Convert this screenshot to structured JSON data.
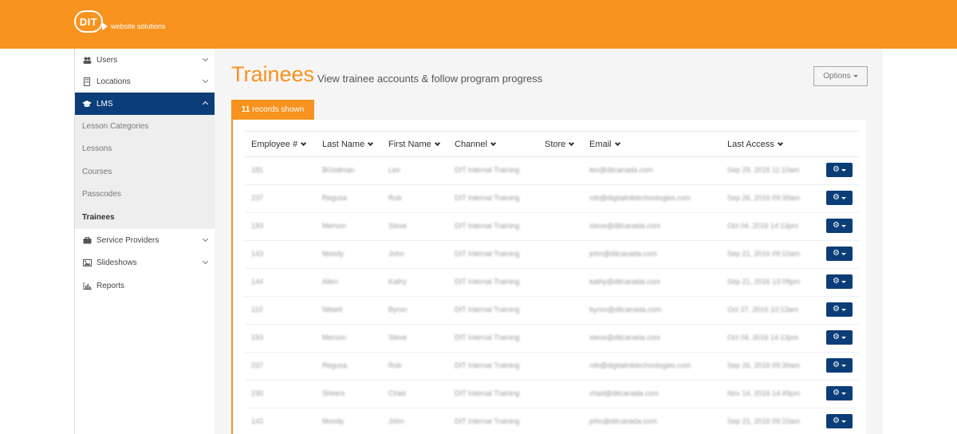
{
  "brand": {
    "logo_text": "DIT",
    "tagline": "website solutions"
  },
  "colors": {
    "accent": "#f7931e",
    "nav_active": "#0b3d78",
    "action_button": "#0b3d78"
  },
  "sidebar": {
    "items": [
      {
        "label": "Users",
        "icon": "users-icon"
      },
      {
        "label": "Locations",
        "icon": "building-icon"
      },
      {
        "label": "LMS",
        "icon": "graduation-cap-icon",
        "active": true
      },
      {
        "label": "Service Providers",
        "icon": "briefcase-icon"
      },
      {
        "label": "Slideshows",
        "icon": "image-icon"
      },
      {
        "label": "Reports",
        "icon": "bar-chart-icon"
      }
    ],
    "lms_subitems": [
      {
        "label": "Lesson Categories"
      },
      {
        "label": "Lessons"
      },
      {
        "label": "Courses"
      },
      {
        "label": "Passcodes"
      },
      {
        "label": "Trainees",
        "current": true
      }
    ]
  },
  "header": {
    "title": "Trainees",
    "subtitle": "View trainee accounts & follow program progress",
    "options_label": "Options"
  },
  "records": {
    "count": "11",
    "suffix": "records shown"
  },
  "table": {
    "columns": [
      "Employee #",
      "Last Name",
      "First Name",
      "Channel",
      "Store",
      "Email",
      "Last Access"
    ],
    "rows": [
      {
        "employee": "181",
        "last": "BGodman",
        "first": "Leo",
        "channel": "DIT Internal Training",
        "store": "",
        "email": "leo@ditcanada.com",
        "last_access": "Sep 29, 2016 11:10am"
      },
      {
        "employee": "237",
        "last": "Regusa",
        "first": "Rob",
        "channel": "DIT Internal Training",
        "store": "",
        "email": "rob@digitalinktechnologies.com",
        "last_access": "Sep 26, 2016 09:39am"
      },
      {
        "employee": "193",
        "last": "Merson",
        "first": "Steve",
        "channel": "DIT Internal Training",
        "store": "",
        "email": "steve@ditcanada.com",
        "last_access": "Oct 04, 2016 14:13pm"
      },
      {
        "employee": "143",
        "last": "Moody",
        "first": "John",
        "channel": "DIT Internal Training",
        "store": "",
        "email": "john@ditcanada.com",
        "last_access": "Sep 21, 2016 09:10am"
      },
      {
        "employee": "144",
        "last": "Allen",
        "first": "Kathy",
        "channel": "DIT Internal Training",
        "store": "",
        "email": "kathy@ditcanada.com",
        "last_access": "Sep 21, 2016 13:09pm"
      },
      {
        "employee": "110",
        "last": "Niblett",
        "first": "Byron",
        "channel": "DIT Internal Training",
        "store": "",
        "email": "byron@ditcanada.com",
        "last_access": "Oct 27, 2016 10:13am"
      },
      {
        "employee": "193",
        "last": "Merson",
        "first": "Steve",
        "channel": "DIT Internal Training",
        "store": "",
        "email": "steve@ditcanada.com",
        "last_access": "Oct 04, 2016 14:13pm"
      },
      {
        "employee": "237",
        "last": "Regusa",
        "first": "Rob",
        "channel": "DIT Internal Training",
        "store": "",
        "email": "rob@digitalinktechnologies.com",
        "last_access": "Sep 26, 2016 09:39am"
      },
      {
        "employee": "230",
        "last": "Sheers",
        "first": "Chad",
        "channel": "DIT Internal Training",
        "store": "",
        "email": "chad@ditcanada.com",
        "last_access": "Nov 14, 2016 14:49pm"
      },
      {
        "employee": "143",
        "last": "Moody",
        "first": "John",
        "channel": "DIT Internal Training",
        "store": "",
        "email": "john@ditcanada.com",
        "last_access": "Sep 21, 2016 09:10am"
      }
    ]
  }
}
